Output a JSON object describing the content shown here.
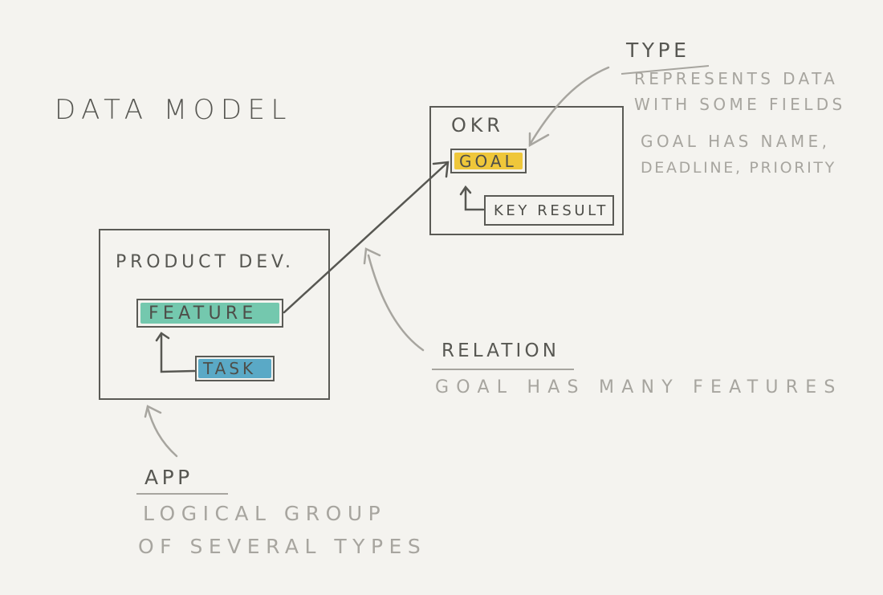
{
  "title": "DATA MODEL",
  "colors": {
    "background": "#f4f3ef",
    "ink": "#575752",
    "pencil": "#a7a59f",
    "goal_fill": "#efc73a",
    "feature_fill": "#74c8ae",
    "task_fill": "#5aa9c6"
  },
  "apps": {
    "okr": {
      "title": "OKR",
      "types": {
        "goal": "GOAL",
        "key_result": "KEY RESULT"
      }
    },
    "product_dev": {
      "title": "PRODUCT DEV.",
      "types": {
        "feature": "FEATURE",
        "task": "TASK"
      }
    }
  },
  "annotations": {
    "type": {
      "heading": "TYPE",
      "lines": [
        "REPRESENTS DATA",
        "WITH SOME FIELDS",
        "GOAL HAS NAME,",
        "DEADLINE, PRIORITY"
      ]
    },
    "relation": {
      "heading": "RELATION",
      "lines": [
        "GOAL HAS MANY FEATURES"
      ]
    },
    "app": {
      "heading": "APP",
      "lines": [
        "LOGICAL GROUP",
        "OF SEVERAL TYPES"
      ]
    }
  }
}
